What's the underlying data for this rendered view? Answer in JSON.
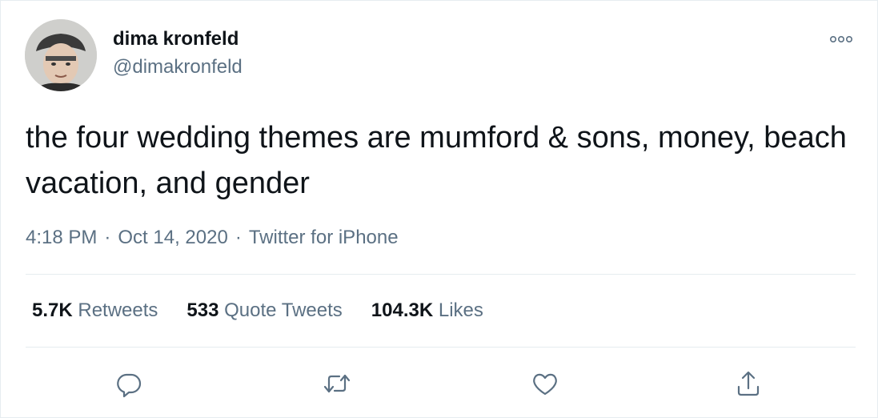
{
  "tweet": {
    "author_name": "dima kronfeld",
    "author_handle": "@dimakronfeld",
    "text": "the four wedding themes are mumford & sons, money, beach vacation, and gender",
    "time": "4:18 PM",
    "date": "Oct 14, 2020",
    "separator": "·",
    "source": "Twitter for iPhone"
  },
  "stats": {
    "retweets_count": "5.7K",
    "retweets_label": "Retweets",
    "quotes_count": "533",
    "quotes_label": "Quote Tweets",
    "likes_count": "104.3K",
    "likes_label": "Likes"
  },
  "icons": {
    "more": "more-horizontal-icon",
    "reply": "reply-icon",
    "retweet": "retweet-icon",
    "like": "like-icon",
    "share": "share-icon"
  },
  "colors": {
    "text": "#0f1419",
    "secondary": "#5b7083",
    "divider": "#e6ecf0"
  }
}
